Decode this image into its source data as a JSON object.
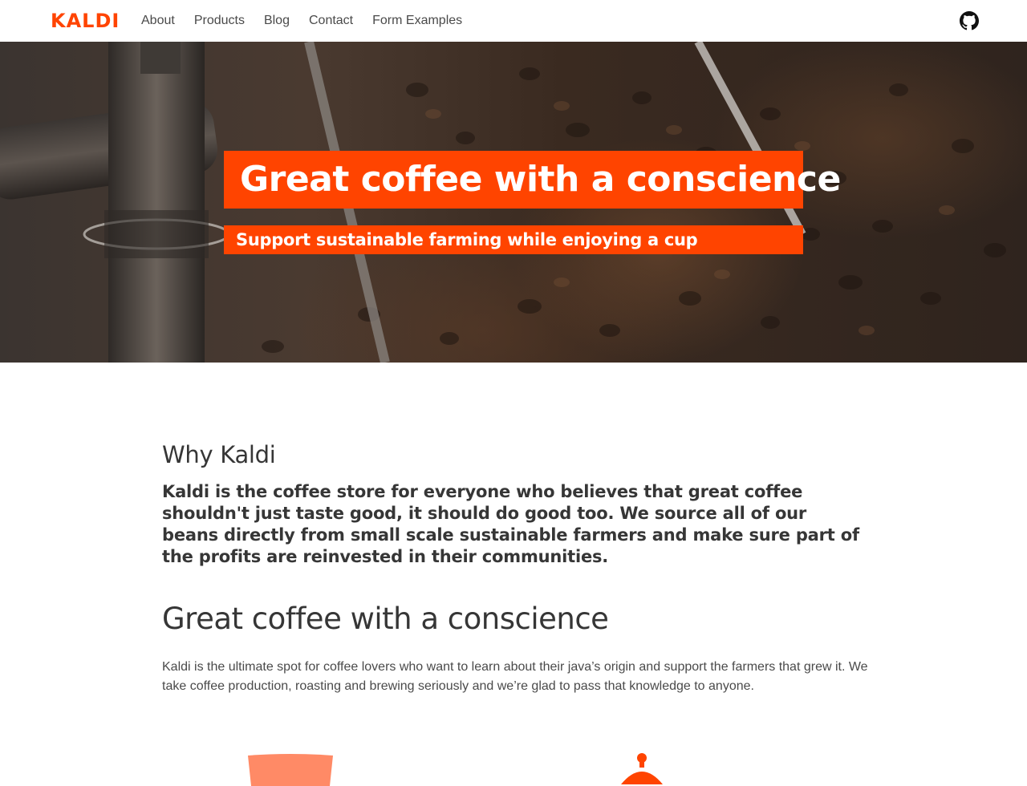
{
  "navbar": {
    "brand": "KALDI",
    "links": [
      "About",
      "Products",
      "Blog",
      "Contact",
      "Form Examples"
    ],
    "github_icon": "github-icon"
  },
  "hero": {
    "title": "Great coffee with a conscience",
    "subtitle": "Support sustainable farming while enjoying a cup"
  },
  "why": {
    "title": "Why Kaldi",
    "text": "Kaldi is the coffee store for everyone who believes that great coffee shouldn't just taste good, it should do good too. We source all of our beans directly from small scale sustainable farmers and make sure part of the profits are reinvested in their communities."
  },
  "section": {
    "title": "Great coffee with a conscience",
    "text": "Kaldi is the ultimate spot for coffee lovers who want to learn about their java’s origin and support the farmers that grew it. We take coffee production, roasting and brewing seriously and we’re glad to pass that knowledge to anyone."
  },
  "icons": {
    "bag": "coffee-bag-icon",
    "pot": "coffee-pot-icon"
  },
  "colors": {
    "accent": "#ff4400",
    "text_dark": "#363636",
    "text_body": "#4a4a4a"
  }
}
